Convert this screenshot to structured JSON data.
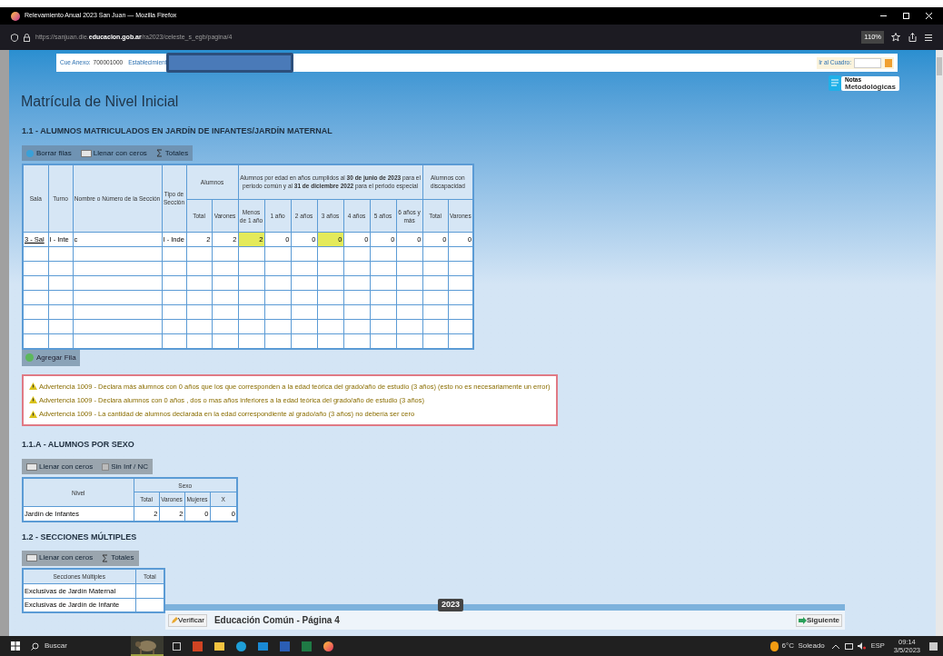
{
  "window": {
    "title": "Relevamiento Anual 2023 San Juan — Mozilla Firefox"
  },
  "browser": {
    "url": "https://sanjuan.die.**educacion.gob.ar**/ra2023/celeste_s_egb/pagina/4",
    "zoom": "110%"
  },
  "header": {
    "cue_label": "Cue Anexo:",
    "cue_value": "700001000",
    "establishment_label": "Establecimient",
    "goto_label": "Ir al Cuadro:",
    "notes_small": "Notas",
    "notes_big": "Metodológicas"
  },
  "page_title": "Matrícula de Nivel Inicial",
  "section_1_1": {
    "title": "1.1 - ALUMNOS MATRICULADOS EN JARDÍN DE INFANTES/JARDÍN MATERNAL",
    "toolbar": [
      {
        "kind": "delete",
        "label": "Borrar filas"
      },
      {
        "kind": "zeros",
        "label": "Llenar con ceros"
      },
      {
        "kind": "totals",
        "label": "Totales"
      }
    ],
    "headers": {
      "sala": "Sala",
      "turno": "Turno",
      "nombre": "Nombre o Número de la Sección",
      "tipo": "Tipo de Sección",
      "alumnos": "Alumnos",
      "edad": "Alumnos por edad en años cumplidos al **30 de junio de 2023** para el periodo común y al **31 de diciembre 2022** para el periodo especial",
      "discapacidad": "Alumnos con discapacidad",
      "sub": [
        "Total",
        "Varones",
        "Menos de 1 año",
        "1 año",
        "2 años",
        "3 años",
        "4 años",
        "5 años",
        "6 años y más",
        "Total",
        "Varones"
      ]
    },
    "rows": [
      {
        "sala": "3 - Sal",
        "turno": "I - Inte",
        "nombre": "c",
        "tipo": "I - Inde",
        "values": [
          {
            "value": "2",
            "highlighted": false
          },
          {
            "value": "2",
            "highlighted": false
          },
          {
            "value": "2",
            "highlighted": true
          },
          {
            "value": "0",
            "highlighted": false
          },
          {
            "value": "0",
            "highlighted": false
          },
          {
            "value": "0",
            "highlighted": true
          },
          {
            "value": "0",
            "highlighted": false
          },
          {
            "value": "0",
            "highlighted": false
          },
          {
            "value": "0",
            "highlighted": false
          },
          {
            "value": "0",
            "highlighted": false
          },
          {
            "value": "0",
            "highlighted": false
          }
        ]
      }
    ],
    "add_row": "Agregar Fila"
  },
  "warnings": [
    "Advertencia 1009 - Declara más alumnos con 0 años que los que corresponden a la edad teórica del grado/año de estudio (3 años) (esto no es necesariamente un error)",
    "Advertencia 1009 - Declara alumnos con 0 años , dos o mas años inferiores a la edad teórica del grado/año de estudio (3 años)",
    "Advertencia 1009 - La cantidad de alumnos declarada en la edad correspondiente al grado/año (3 años) no debería ser cero"
  ],
  "section_1_1a": {
    "title": "1.1.A - ALUMNOS POR SEXO",
    "toolbar": [
      {
        "kind": "zeros",
        "label": "Llenar con ceros"
      },
      {
        "kind": "checkbox",
        "label": "Sin Inf / NC",
        "checked": false
      }
    ],
    "headers": {
      "nivel": "Nivel",
      "sexo": "Sexo",
      "sub": [
        "Total",
        "Varones",
        "Mujeres",
        "X"
      ]
    },
    "rows": [
      {
        "label": "Jardín de Infantes",
        "values": [
          "2",
          "2",
          "0",
          "0"
        ]
      }
    ]
  },
  "section_1_2": {
    "title": "1.2 - SECCIONES MÚLTIPLES",
    "toolbar": [
      {
        "kind": "zeros",
        "label": "Llenar con ceros"
      },
      {
        "kind": "totals",
        "label": "Totales"
      }
    ],
    "headers": [
      "Secciones Múltiples",
      "Total"
    ],
    "rows": [
      "Exclusivas de Jardín Maternal",
      "Exclusivas de Jardín de Infante"
    ]
  },
  "footer": {
    "verify": "Verificar",
    "title": "Educación Común - Página 4",
    "year": "2023",
    "next": "Siguiente"
  },
  "taskbar": {
    "search": "Buscar",
    "weather": "6°C  Soleado",
    "language": "ESP",
    "time": "09:14",
    "date": "3/5/2023"
  }
}
